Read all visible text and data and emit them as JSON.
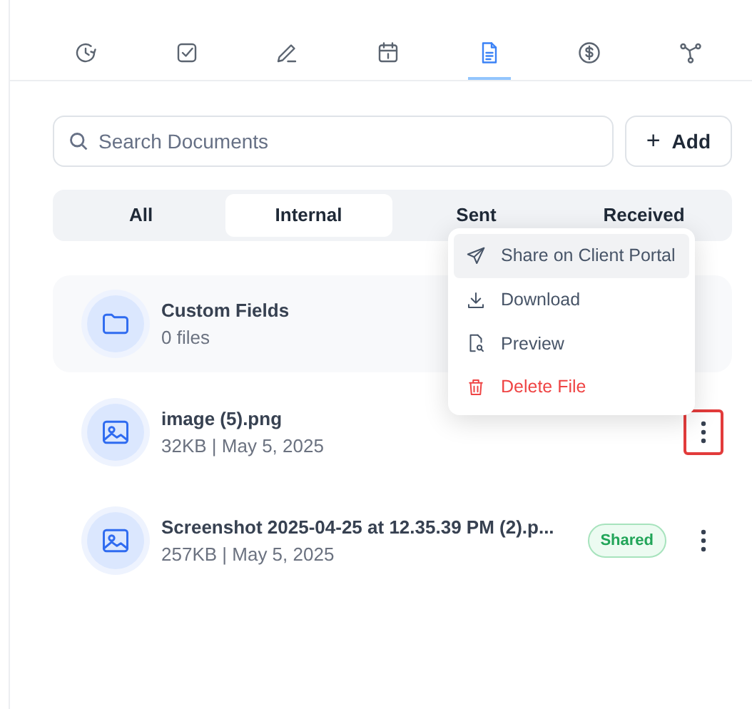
{
  "nav_tabs": [
    {
      "selected": false
    },
    {
      "selected": false
    },
    {
      "selected": false
    },
    {
      "selected": false
    },
    {
      "selected": true
    },
    {
      "selected": false
    },
    {
      "selected": false
    }
  ],
  "search": {
    "placeholder": "Search Documents"
  },
  "add_button": {
    "label": "Add",
    "icon": "+"
  },
  "filter_tabs": [
    {
      "label": "All",
      "selected": false
    },
    {
      "label": "Internal",
      "selected": true
    },
    {
      "label": "Sent",
      "selected": false
    },
    {
      "label": "Received",
      "selected": false
    }
  ],
  "items": [
    {
      "kind": "folder",
      "name": "Custom Fields",
      "meta": "0 files"
    },
    {
      "kind": "image",
      "name": "image (5).png",
      "meta": "32KB | May 5, 2025",
      "menu_highlighted": true
    },
    {
      "kind": "image",
      "name": "Screenshot 2025-04-25 at 12.35.39 PM (2).p...",
      "meta": "257KB | May 5, 2025",
      "badge": "Shared",
      "menu_highlighted": false
    }
  ],
  "context_menu": [
    {
      "label": "Share on Client Portal",
      "kind": "normal",
      "highlighted": true
    },
    {
      "label": "Download",
      "kind": "normal",
      "highlighted": false
    },
    {
      "label": "Preview",
      "kind": "normal",
      "highlighted": false
    },
    {
      "label": "Delete File",
      "kind": "danger",
      "highlighted": false
    }
  ]
}
